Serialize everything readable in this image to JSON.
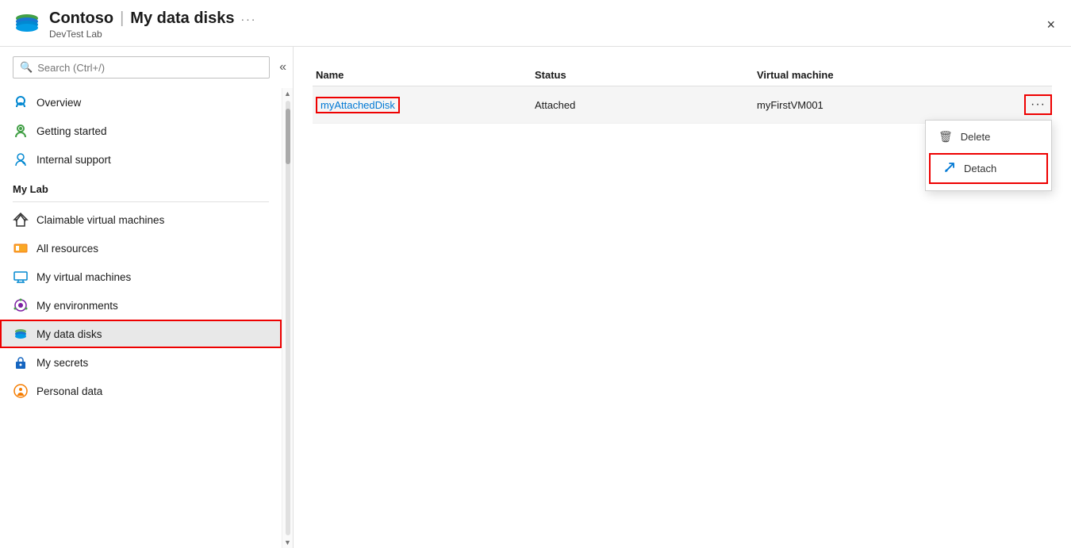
{
  "header": {
    "icon_alt": "Contoso DevTest Lab icon",
    "brand": "Contoso",
    "separator": "|",
    "title": "My data disks",
    "subtitle": "DevTest Lab",
    "ellipsis": "···",
    "close_label": "×"
  },
  "sidebar": {
    "search_placeholder": "Search (Ctrl+/)",
    "collapse_label": "«",
    "items_top": [
      {
        "id": "overview",
        "label": "Overview",
        "icon": "overview"
      },
      {
        "id": "getting-started",
        "label": "Getting started",
        "icon": "getting-started"
      },
      {
        "id": "internal-support",
        "label": "Internal support",
        "icon": "internal-support"
      }
    ],
    "section_my_lab": "My Lab",
    "items_my_lab": [
      {
        "id": "claimable-vms",
        "label": "Claimable virtual machines",
        "icon": "claimable-vms"
      },
      {
        "id": "all-resources",
        "label": "All resources",
        "icon": "all-resources"
      },
      {
        "id": "my-vms",
        "label": "My virtual machines",
        "icon": "my-vms"
      },
      {
        "id": "my-environments",
        "label": "My environments",
        "icon": "my-environments"
      },
      {
        "id": "my-data-disks",
        "label": "My data disks",
        "icon": "my-data-disks",
        "active": true
      },
      {
        "id": "my-secrets",
        "label": "My secrets",
        "icon": "my-secrets"
      },
      {
        "id": "personal-data",
        "label": "Personal data",
        "icon": "personal-data"
      }
    ]
  },
  "table": {
    "col_name": "Name",
    "col_status": "Status",
    "col_vm": "Virtual machine",
    "rows": [
      {
        "name": "myAttachedDisk",
        "status": "Attached",
        "vm": "myFirstVM001"
      }
    ]
  },
  "context_menu": {
    "delete_label": "Delete",
    "detach_label": "Detach"
  }
}
